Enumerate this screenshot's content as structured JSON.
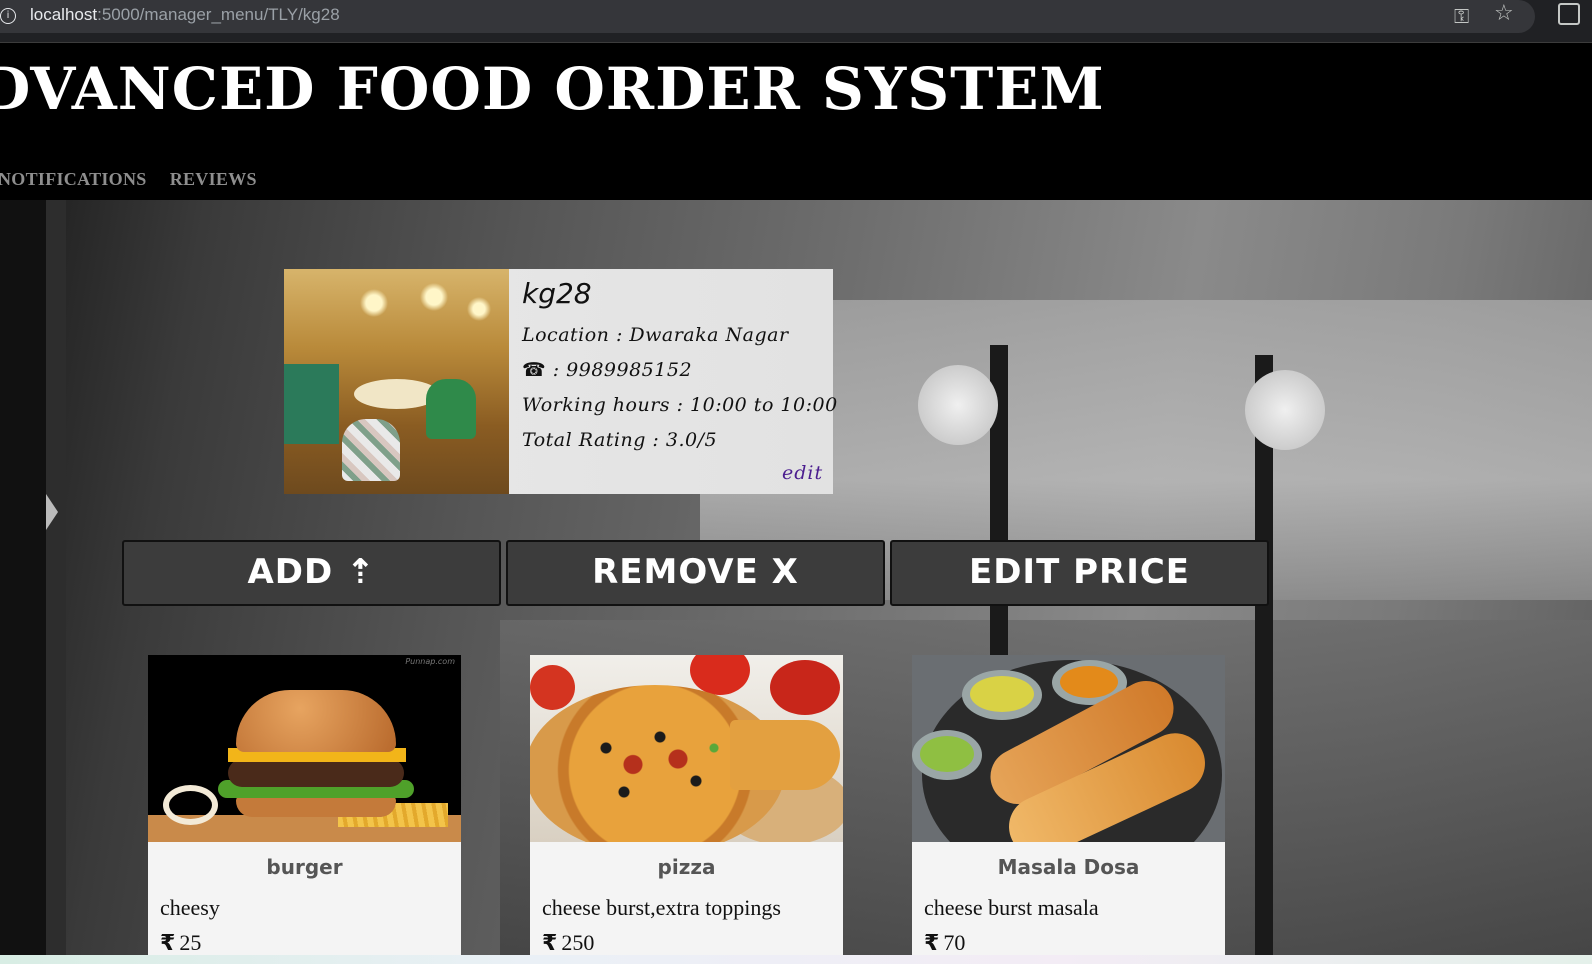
{
  "browser": {
    "url_host": "localhost",
    "url_path": ":5000/manager_menu/TLY/kg28",
    "key_icon": "key-icon",
    "star_icon": "star-icon",
    "extensions_icon": "extensions-icon"
  },
  "header": {
    "title": "DVANCED FOOD ORDER SYSTEM",
    "nav": [
      {
        "label": "NOTIFICATIONS"
      },
      {
        "label": "REVIEWS"
      }
    ]
  },
  "restaurant": {
    "name": "kg28",
    "location": "Location : Dwaraka Nagar",
    "phone_icon": "☎",
    "phone": " : 9989985152",
    "working_hours": "Working hours : 10:00 to 10:00",
    "rating": "Total Rating : 3.0/5",
    "edit_label": "edit"
  },
  "actions": {
    "add_label": "ADD ⇡",
    "remove_label": "REMOVE X",
    "edit_price_label": "EDIT PRICE"
  },
  "menu": {
    "currency": "₹",
    "items": [
      {
        "name": "burger",
        "description": "cheesy",
        "price": "25",
        "watermark": "Punnap.com"
      },
      {
        "name": "pizza",
        "description": "cheese burst,extra toppings",
        "price": "250"
      },
      {
        "name": "Masala Dosa",
        "description": "cheese burst masala",
        "price": "70"
      }
    ]
  }
}
